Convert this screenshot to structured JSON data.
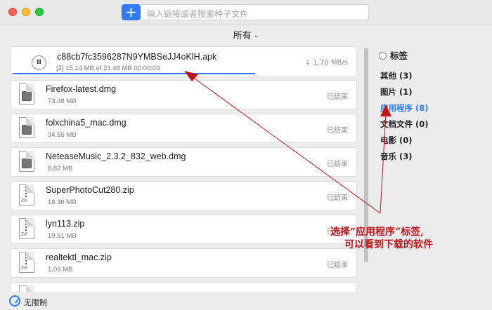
{
  "toolbar": {
    "add_label": "+",
    "search_placeholder": "输入链接或者搜索种子文件"
  },
  "filter": {
    "label": "所有",
    "chevron": "⌄"
  },
  "active_download": {
    "name": "c88cb7fc3596287N9YMBSeJJ4oKlH.apk",
    "meta": "[2] 15.14 MB of 21.48 MB  00:00:03",
    "speed": "↓ 1.70 MB/s",
    "pause_glyph": "II",
    "progress": 0.705
  },
  "downloads": [
    {
      "name": "Firefox-latest.dmg",
      "size": "73.48 MB",
      "status": "已结束",
      "icon": "dmg-file-icon"
    },
    {
      "name": "folxchina5_mac.dmg",
      "size": "34.65 MB",
      "status": "已结束",
      "icon": "dmg-file-icon"
    },
    {
      "name": "NeteaseMusic_2.3.2_832_web.dmg",
      "size": "8.82 MB",
      "status": "已结束",
      "icon": "dmg-file-icon"
    },
    {
      "name": "SuperPhotoCut280.zip",
      "size": "18.36 MB",
      "status": "已结束",
      "icon": "zip-file-icon"
    },
    {
      "name": "lyn113.zip",
      "size": "19.51 MB",
      "status": "已结束",
      "icon": "zip-file-icon"
    },
    {
      "name": "realtektl_mac.zip",
      "size": "1.09 MB",
      "status": "已结束",
      "icon": "zip-file-icon"
    }
  ],
  "zip_badge": "ZIP",
  "sidebar": {
    "header": "标签",
    "categories": [
      {
        "label": "其他 (3)"
      },
      {
        "label": "图片 (1)"
      },
      {
        "label": "应用程序 (8)"
      },
      {
        "label": "文档文件 (0)"
      },
      {
        "label": "电影 (0)"
      },
      {
        "label": "音乐 (3)"
      }
    ],
    "selected_index": 2
  },
  "bottom": {
    "speed_limit": "无限制"
  },
  "annotation": {
    "line1": "选择“应用程序”标签,",
    "line2": "可以看到下载的软件"
  },
  "colors": {
    "accent": "#2f7cf6",
    "annotation": "#c0141b"
  }
}
